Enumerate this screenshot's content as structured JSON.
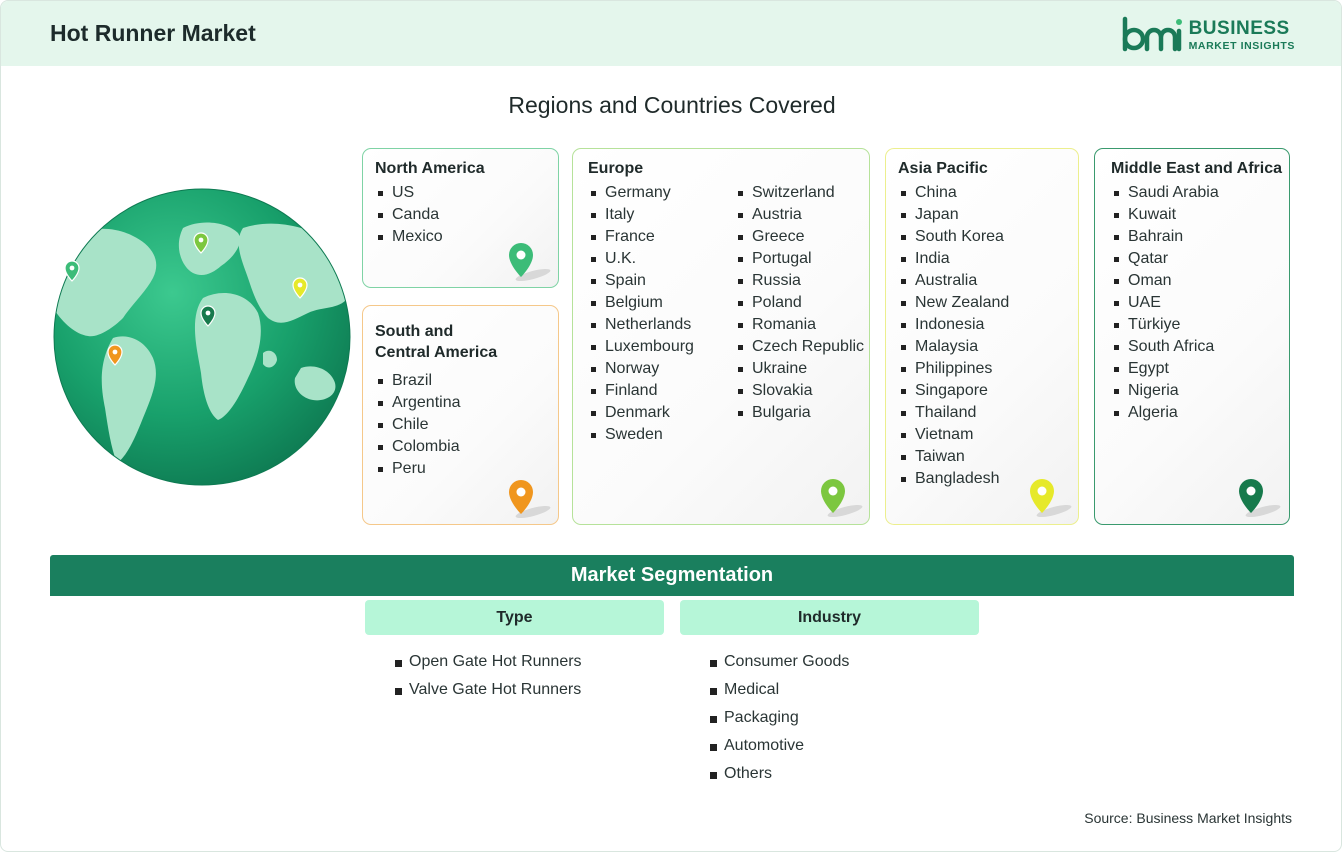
{
  "header": {
    "title": "Hot Runner Market",
    "logo": {
      "line1": "BUSINESS",
      "line2": "MARKET INSIGHTS",
      "brand_color": "#1a7a58"
    }
  },
  "regions_section": {
    "title": "Regions and Countries Covered",
    "globe": {
      "ocean_color": "#1e9e6c",
      "land_color": "#a8e3c8",
      "icon": "globe-icon"
    }
  },
  "regions": [
    {
      "key": "north-america",
      "name": "North America",
      "border_color": "#7fd3a5",
      "pin_color": "#3cbc78",
      "countries": [
        "US",
        "Canda",
        "Mexico"
      ]
    },
    {
      "key": "south-central-america",
      "name_lines": [
        "South and",
        "Central America"
      ],
      "border_color": "#f5c88a",
      "pin_color": "#f0961e",
      "countries": [
        "Brazil",
        "Argentina",
        "Chile",
        "Colombia",
        "Peru"
      ]
    },
    {
      "key": "europe",
      "name": "Europe",
      "border_color": "#b6e29a",
      "pin_color": "#7cc73f",
      "columns": [
        [
          "Germany",
          "Italy",
          "France",
          "U.K.",
          "Spain",
          "Belgium",
          "Netherlands",
          "Luxembourg",
          "Norway",
          "Finland",
          "Denmark",
          "Sweden"
        ],
        [
          "Switzerland",
          "Austria",
          "Greece",
          "Portugal",
          "Russia",
          "Poland",
          "Romania",
          "Czech Republic",
          "Ukraine",
          "Slovakia",
          "Bulgaria"
        ]
      ]
    },
    {
      "key": "asia-pacific",
      "name": "Asia Pacific",
      "border_color": "#ecef8e",
      "pin_color": "#e6e92a",
      "countries": [
        "China",
        "Japan",
        "South Korea",
        "India",
        "Australia",
        "New Zealand",
        "Indonesia",
        "Malaysia",
        "Philippines",
        "Singapore",
        "Thailand",
        "Vietnam",
        "Taiwan",
        "Bangladesh"
      ]
    },
    {
      "key": "middle-east-africa",
      "name": "Middle East and Africa",
      "border_color": "#3a9a6e",
      "pin_color": "#177a4c",
      "countries": [
        "Saudi Arabia",
        "Kuwait",
        "Bahrain",
        "Qatar",
        "Oman",
        "UAE",
        "Türkiye",
        "South Africa",
        "Egypt",
        "Nigeria",
        "Algeria"
      ]
    }
  ],
  "segmentation": {
    "title": "Market Segmentation",
    "band_color": "#1a7f5e",
    "groups": [
      {
        "title": "Type",
        "items": [
          "Open Gate Hot Runners",
          "Valve Gate Hot Runners"
        ]
      },
      {
        "title": "Industry",
        "items": [
          "Consumer Goods",
          "Medical",
          "Packaging",
          "Automotive",
          "Others"
        ]
      }
    ]
  },
  "source": "Source: Business Market Insights"
}
